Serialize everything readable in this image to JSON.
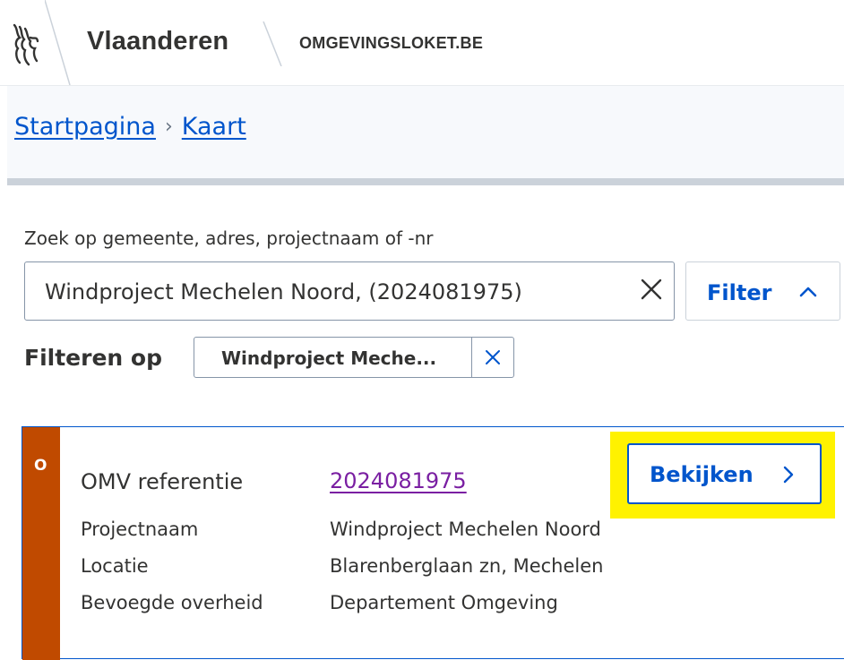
{
  "header": {
    "brand": "Vlaanderen",
    "site_name": "OMGEVINGSLOKET.BE"
  },
  "breadcrumb": {
    "items": [
      {
        "label": "Startpagina"
      },
      {
        "label": "Kaart"
      }
    ],
    "separator": "›"
  },
  "search": {
    "label": "Zoek op gemeente, adres, projectnaam of -nr",
    "value": "Windproject Mechelen Noord, (2024081975)",
    "filter_label": "Filter"
  },
  "filters": {
    "label": "Filteren op",
    "chips": [
      {
        "text": "Windproject Meche..."
      }
    ]
  },
  "result": {
    "status_letter": "O",
    "status_color": "#c04a00",
    "fields": {
      "ref_label": "OMV referentie",
      "ref_value": "2024081975",
      "project_label": "Projectnaam",
      "project_value": "Windproject Mechelen Noord",
      "location_label": "Locatie",
      "location_value": "Blarenberglaan zn, Mechelen",
      "authority_label": "Bevoegde overheid",
      "authority_value": "Departement Omgeving"
    },
    "view_label": "Bekijken"
  },
  "colors": {
    "accent": "#0055cc",
    "visited_link": "#7a1fa2",
    "highlight": "#fff200"
  }
}
